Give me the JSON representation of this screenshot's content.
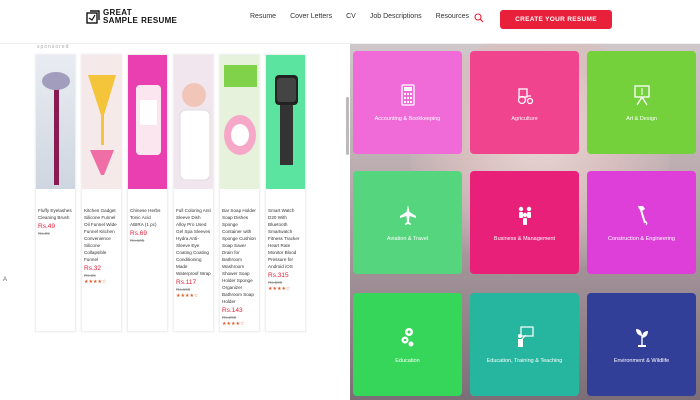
{
  "header": {
    "logo_line1": "GREAT",
    "logo_line2a": "SAMPLE",
    "logo_line2b": "RESUME",
    "nav": [
      "Resume",
      "Cover Letters",
      "CV",
      "Job Descriptions",
      "Resources"
    ],
    "cta_label": "CREATE YOUR RESUME",
    "accent_color": "#e8203a"
  },
  "ads": {
    "label": "sponsored",
    "products": [
      {
        "title": "Fluffy Eyelashes Cleaning Brush",
        "price": "Rs.49",
        "mrp": "Rs.99",
        "stars": "★★★★☆",
        "image_color": "#a29dbd"
      },
      {
        "title": "Kitchen Gadget Silicone Funnel Oil Funnel Wide Funnel Kitchen Convenience Silicone Collapsible Funnel",
        "price": "Rs.32",
        "mrp": "Rs.65",
        "stars": "★★★★☆",
        "image_color": "#f4d36e"
      },
      {
        "title": "Chinese Herbs Tonic Acid ABIRA (1 pc)",
        "price": "Rs.69",
        "mrp": "Rs.105",
        "stars": "★★★★☆",
        "image_color": "#e93fb1"
      },
      {
        "title": "Full Coloring Anti Sleeve Dish Alloy Pro Used Gel Spa Sleeves Hydra Anti-Sleeve Eye Coating Coating Conditioning Made Waterproof Wrap",
        "price": "Rs.117",
        "mrp": "Rs.199",
        "stars": "★★★★☆",
        "image_color": "#f2e6ee"
      },
      {
        "title": "Bar Soap Holder Soap Dishes Sponge Container with Sponge Cushion Soap Saver Drain for Bathroom Washroom Shower Soap Holder Sponge Organizer Bathroom Soap Holder",
        "price": "Rs.143",
        "mrp": "Rs.299",
        "stars": "★★★★☆",
        "image_color": "#e6f2dc"
      },
      {
        "title": "Smart Watch D20 With Bluetooth Smartwatch Fitness Tracker Heart Rate Monitor Blood Pressure for Android iOS",
        "price": "Rs.315",
        "mrp": "Rs.599",
        "stars": "★★★★☆",
        "image_color": "#5be3a0"
      }
    ]
  },
  "categories": [
    {
      "label": "Accounting & Bookkeeping",
      "color": "#f06bd8",
      "icon": "calculator-icon"
    },
    {
      "label": "Agriculture",
      "color": "#f0448f",
      "icon": "tractor-icon"
    },
    {
      "label": "Art & Design",
      "color": "#75d13b",
      "icon": "easel-icon"
    },
    {
      "label": "Aviation & Travel",
      "color": "#55d57e",
      "icon": "airplane-icon"
    },
    {
      "label": "Business & Management",
      "color": "#e8207a",
      "icon": "team-icon"
    },
    {
      "label": "Construction & Engineering",
      "color": "#de3fd8",
      "icon": "hammer-icon"
    },
    {
      "label": "Education",
      "color": "#36d65a",
      "icon": "gears-icon"
    },
    {
      "label": "Education, Training & Teaching",
      "color": "#26b6a0",
      "icon": "teacher-icon"
    },
    {
      "label": "Environment & Wildlife",
      "color": "#313f98",
      "icon": "plant-icon"
    }
  ],
  "misc": {
    "left_arrow": "A"
  }
}
